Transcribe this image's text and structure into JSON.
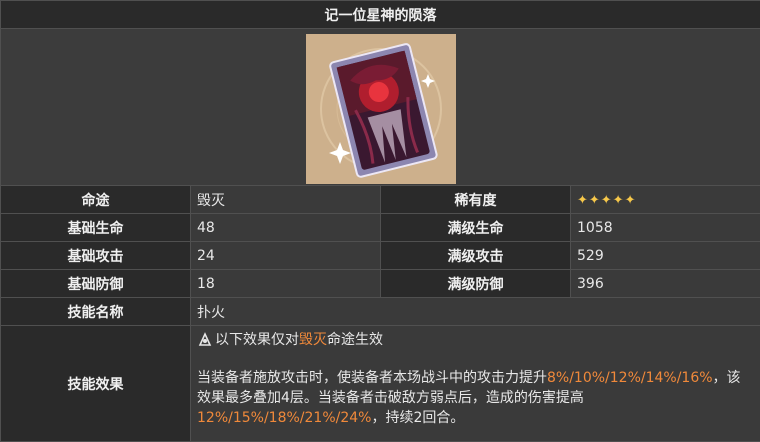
{
  "title": "记一位星神的陨落",
  "rows": [
    {
      "l1": "命途",
      "v1": "毁灭",
      "l2": "稀有度",
      "v2": "✦✦✦✦✦"
    },
    {
      "l1": "基础生命",
      "v1": "48",
      "l2": "满级生命",
      "v2": "1058"
    },
    {
      "l1": "基础攻击",
      "v1": "24",
      "l2": "满级攻击",
      "v2": "529"
    },
    {
      "l1": "基础防御",
      "v1": "18",
      "l2": "满级防御",
      "v2": "396"
    }
  ],
  "skill": {
    "label": "技能名称",
    "name": "扑火"
  },
  "effect": {
    "label": "技能效果",
    "note_prefix": "以下效果仅对",
    "note_path": "毁灭",
    "note_suffix": "命途生效",
    "line1_a": "当装备者施放攻击时，使装备者本场战斗中的攻击力提升",
    "line1_hl": "8%/10%/12%/14%/16%",
    "line1_b": "，该效果最多叠加4层。当装备者击破敌方弱点后，造成的伤害提高",
    "line2_hl": "12%/15%/18%/21%/24%",
    "line2_b": "，持续2回合。"
  },
  "colors": {
    "highlight": "#f0893a",
    "star": "#f7c84a"
  },
  "icons": {
    "card": "light-cone-card-image",
    "note": "path-note-icon"
  }
}
